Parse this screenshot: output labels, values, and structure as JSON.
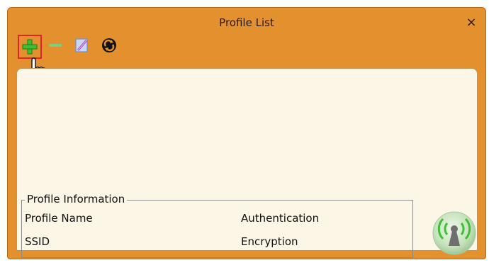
{
  "window": {
    "title": "Profile List",
    "close_glyph": "×"
  },
  "toolbar": {
    "buttons": [
      {
        "name": "add-profile",
        "icon": "plus-icon",
        "color": "#3fbf33"
      },
      {
        "name": "remove-profile",
        "icon": "minus-icon",
        "color": "#7ccf7a"
      },
      {
        "name": "edit-profile",
        "icon": "edit-icon",
        "color": "#6a8fd8"
      },
      {
        "name": "sync-profile",
        "icon": "sync-icon",
        "color": "#111111"
      }
    ]
  },
  "profile_information": {
    "legend": "Profile Information",
    "profile_name_label": "Profile Name",
    "ssid_label": "SSID",
    "authentication_label": "Authentication",
    "encryption_label": "Encryption"
  },
  "colors": {
    "titlebar": "#e2912e",
    "content_bg": "#fbf6e6",
    "add_highlight": "#e12424"
  }
}
